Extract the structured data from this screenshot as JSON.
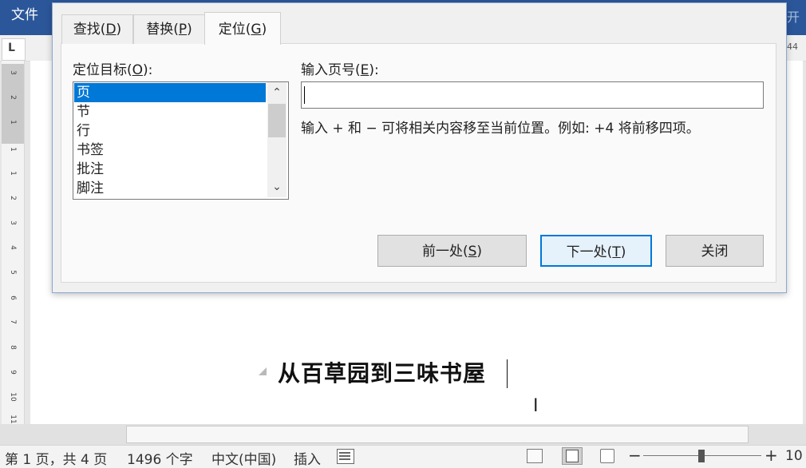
{
  "word": {
    "file_tab": "文件",
    "ribbon_right_text": "开",
    "ruler_corner": "L",
    "ruler_right_number": "44",
    "vertical_ruler_numbers": [
      "3",
      "2",
      "1",
      "1",
      "1",
      "2",
      "3",
      "4",
      "5",
      "6",
      "7",
      "8",
      "9",
      "10",
      "11"
    ],
    "document_title": "从百草园到三味书屋"
  },
  "dialog": {
    "tabs": [
      {
        "label": "查找(",
        "key": "D",
        "suffix": ")"
      },
      {
        "label": "替换(",
        "key": "P",
        "suffix": ")"
      },
      {
        "label": "定位(",
        "key": "G",
        "suffix": ")"
      }
    ],
    "active_tab": "定位(G)",
    "goto_what": {
      "label_pre": "定位目标(",
      "label_key": "O",
      "label_post": "):",
      "items": [
        "页",
        "节",
        "行",
        "书签",
        "批注",
        "脚注"
      ],
      "selected": "页"
    },
    "page_number": {
      "label_pre": "输入页号(",
      "label_key": "E",
      "label_post": "):",
      "value": "",
      "hint": "输入 + 和 − 可将相关内容移至当前位置。例如: +4 将前移四项。"
    },
    "buttons": {
      "previous": {
        "pre": "前一处(",
        "key": "S",
        "post": ")"
      },
      "next": {
        "pre": "下一处(",
        "key": "T",
        "post": ")"
      },
      "close": "关闭"
    }
  },
  "status_bar": {
    "page": "第 1 页，共 4 页",
    "words": "1496 个字",
    "language": "中文(中国)",
    "mode": "插入",
    "zoom": "10"
  },
  "colors": {
    "ribbon": "#2b579a",
    "selection": "#0078d7",
    "default_button_border": "#0078d7"
  }
}
